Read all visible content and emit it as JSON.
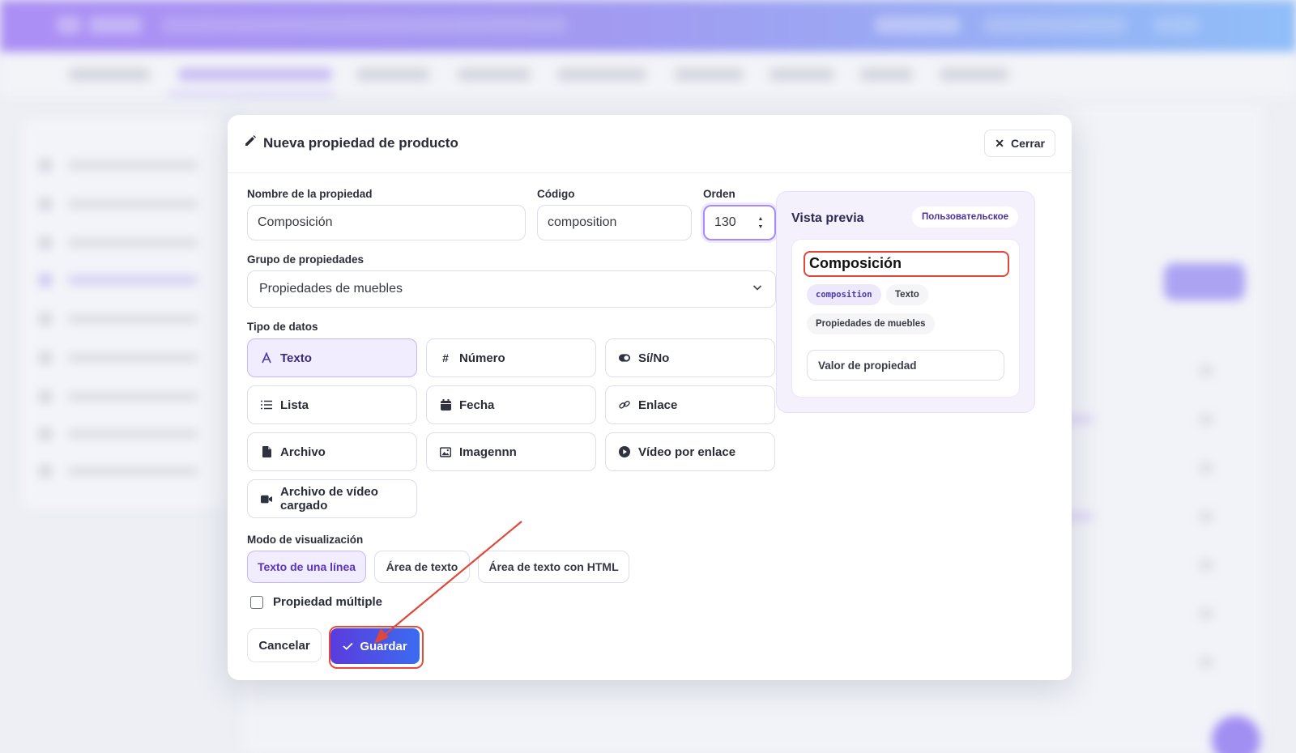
{
  "modal": {
    "title": "Nueva propiedad de producto",
    "title_icon": "pencil-icon",
    "close_label": "Cerrar"
  },
  "form": {
    "name_label": "Nombre de la propiedad",
    "name_value": "Composición",
    "code_label": "Código",
    "code_value": "composition",
    "order_label": "Orden",
    "order_value": "130",
    "group_label": "Grupo de propiedades",
    "group_value": "Propiedades de muebles",
    "type_label": "Tipo de datos",
    "types": [
      {
        "label": "Texto",
        "icon": "text-a-icon",
        "selected": true
      },
      {
        "label": "Número",
        "icon": "hash-icon",
        "selected": false
      },
      {
        "label": "Sí/No",
        "icon": "toggle-icon",
        "selected": false
      },
      {
        "label": "Lista",
        "icon": "list-icon",
        "selected": false
      },
      {
        "label": "Fecha",
        "icon": "calendar-icon",
        "selected": false
      },
      {
        "label": "Enlace",
        "icon": "link-icon",
        "selected": false
      },
      {
        "label": "Archivo",
        "icon": "file-icon",
        "selected": false
      },
      {
        "label": "Imagennn",
        "icon": "image-icon",
        "selected": false
      },
      {
        "label": "Vídeo por enlace",
        "icon": "play-circle-icon",
        "selected": false
      },
      {
        "label": "Archivo de vídeo cargado",
        "icon": "video-camera-icon",
        "selected": false
      }
    ],
    "mode_label": "Modo de visualización",
    "modes": [
      {
        "label": "Texto de una línea",
        "selected": true
      },
      {
        "label": "Área de texto",
        "selected": false
      },
      {
        "label": "Área de texto con HTML",
        "selected": false
      }
    ],
    "multiple_label": "Propiedad múltiple",
    "multiple_checked": false,
    "cancel_label": "Cancelar",
    "save_label": "Guardar"
  },
  "preview": {
    "title": "Vista previa",
    "badge": "Пользовательское",
    "name": "Composición",
    "code_chip": "composition",
    "type_chip": "Texto",
    "group_chip": "Propiedades de muebles",
    "value_placeholder": "Valor de propiedad"
  },
  "colors": {
    "accent": "#6d4ce8",
    "annotation": "#e0463a",
    "header_gradient_start": "#8b5cf6",
    "header_gradient_end": "#60a5fa"
  }
}
